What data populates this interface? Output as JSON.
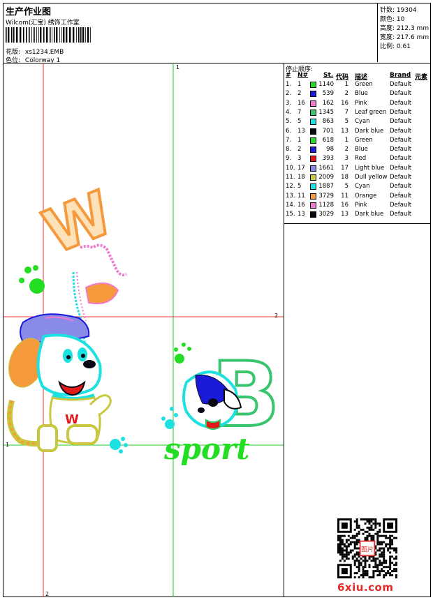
{
  "header": {
    "title": "生产作业图",
    "company": "Wilcom(汇宝) 绣饰工作室",
    "design_label": "花版:",
    "design_value": "xs1234.EMB",
    "colorway_label": "色位:",
    "colorway_value": "Colorway 1"
  },
  "stats": [
    {
      "label": "针数:",
      "value": "19304"
    },
    {
      "label": "颜色:",
      "value": "10"
    },
    {
      "label": "高度:",
      "value": "212.3 mm"
    },
    {
      "label": "宽度:",
      "value": "217.6 mm"
    },
    {
      "label": "比例:",
      "value": "0.61"
    }
  ],
  "sequence": {
    "title": "停止顺序:",
    "columns": [
      "#",
      "N#",
      "St.",
      "代码",
      "描述",
      "Brand",
      "元素"
    ],
    "rows": [
      {
        "idx": "1.",
        "n": "1",
        "color": "#22dd22",
        "st": "1140",
        "code": "1",
        "desc": "Green",
        "brand": "Default"
      },
      {
        "idx": "2.",
        "n": "2",
        "color": "#1a1ad8",
        "st": "539",
        "code": "2",
        "desc": "Blue",
        "brand": "Default"
      },
      {
        "idx": "3.",
        "n": "16",
        "color": "#f07ad0",
        "st": "162",
        "code": "16",
        "desc": "Pink",
        "brand": "Default"
      },
      {
        "idx": "4.",
        "n": "7",
        "color": "#39c46e",
        "st": "1345",
        "code": "7",
        "desc": "Leaf green",
        "brand": "Default"
      },
      {
        "idx": "5.",
        "n": "5",
        "color": "#1de0e0",
        "st": "863",
        "code": "5",
        "desc": "Cyan",
        "brand": "Default"
      },
      {
        "idx": "6.",
        "n": "13",
        "color": "#0a0a14",
        "st": "701",
        "code": "13",
        "desc": "Dark blue",
        "brand": "Default"
      },
      {
        "idx": "7.",
        "n": "1",
        "color": "#22dd22",
        "st": "618",
        "code": "1",
        "desc": "Green",
        "brand": "Default"
      },
      {
        "idx": "8.",
        "n": "2",
        "color": "#1a1ad8",
        "st": "98",
        "code": "2",
        "desc": "Blue",
        "brand": "Default"
      },
      {
        "idx": "9.",
        "n": "3",
        "color": "#e21a1a",
        "st": "393",
        "code": "3",
        "desc": "Red",
        "brand": "Default"
      },
      {
        "idx": "10.",
        "n": "17",
        "color": "#8a8ae8",
        "st": "1661",
        "code": "17",
        "desc": "Light blue",
        "brand": "Default"
      },
      {
        "idx": "11.",
        "n": "18",
        "color": "#c9c640",
        "st": "2009",
        "code": "18",
        "desc": "Dull yellow",
        "brand": "Default"
      },
      {
        "idx": "12.",
        "n": "5",
        "color": "#1de0e0",
        "st": "1887",
        "code": "5",
        "desc": "Cyan",
        "brand": "Default"
      },
      {
        "idx": "13.",
        "n": "11",
        "color": "#f59a3c",
        "st": "3729",
        "code": "11",
        "desc": "Orange",
        "brand": "Default"
      },
      {
        "idx": "14.",
        "n": "16",
        "color": "#f07ad0",
        "st": "1128",
        "code": "16",
        "desc": "Pink",
        "brand": "Default"
      },
      {
        "idx": "15.",
        "n": "13",
        "color": "#0a0a14",
        "st": "3029",
        "code": "13",
        "desc": "Dark blue",
        "brand": "Default"
      }
    ]
  },
  "design": {
    "letter_w": "W",
    "letter_b": "B",
    "script": "sport",
    "shirt_letter": "W"
  },
  "axes": {
    "h1": "1",
    "h2": "2",
    "v1": "1",
    "v2": "2"
  },
  "watermark": "6xiu.com",
  "stamp": "图片"
}
